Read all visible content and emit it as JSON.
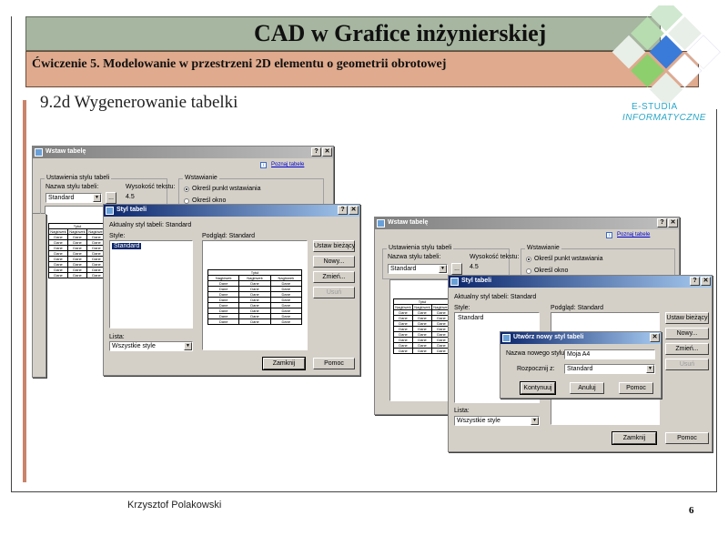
{
  "slide": {
    "title": "CAD w Grafice inżynierskiej",
    "subtitle": "Ćwiczenie 5. Modelowanie w przestrzeni 2D elementu o geometrii obrotowej",
    "section_heading": "9.2d Wygenerowanie tabelki",
    "author": "Krzysztof Polakowski",
    "page_number": "6",
    "logo_line1": "E-STUDIA",
    "logo_line2": "INFORMATYCZNE"
  },
  "colors": {
    "title_bar": "#a7b6a0",
    "subtitle_bar": "#dfaa8d",
    "accent_line": "#c9846a",
    "logo_blue": "#2aa7c9"
  },
  "insert_table_left": {
    "title": "Wstaw tabelę",
    "help_btn": "?",
    "close_btn": "✕",
    "learn_link": "Poznaj tabele",
    "style_group": "Ustawienia stylu tabeli",
    "style_name_label": "Nazwa stylu tabeli:",
    "style_value": "Standard",
    "browse_btn": "...",
    "text_height_label": "Wysokość tekstu:",
    "text_height_value": "4.5",
    "insert_group": "Wstawianie",
    "radio_point": "Określ punkt wstawiania",
    "radio_window": "Określ okno"
  },
  "table_style_left": {
    "title": "Styl tabeli",
    "help_btn": "?",
    "close_btn": "✕",
    "current_label": "Aktualny styl tabeli: Standard",
    "styles_label": "Style:",
    "styles": [
      "Standard"
    ],
    "preview_label": "Podgląd: Standard",
    "list_label": "Lista:",
    "list_value": "Wszystkie style",
    "btn_set_current": "Ustaw bieżący",
    "btn_new": "Nowy...",
    "btn_modify": "Zmień...",
    "btn_delete": "Usuń",
    "btn_close": "Zamknij",
    "btn_help": "Pomoc"
  },
  "preview_table": {
    "title": "Tytuł",
    "headers": [
      "Nagłówek",
      "Nagłówek",
      "Nagłówek"
    ],
    "cell": "Dane",
    "rows": 8
  },
  "insert_table_right": {
    "title": "Wstaw tabelę",
    "help_btn": "?",
    "close_btn": "✕",
    "learn_link": "Poznaj tabele",
    "style_group": "Ustawienia stylu tabeli",
    "style_name_label": "Nazwa stylu tabeli:",
    "style_value": "Standard",
    "browse_btn": "...",
    "text_height_label": "Wysokość tekstu:",
    "text_height_value": "4.5",
    "insert_group": "Wstawianie",
    "radio_point": "Określ punkt wstawiania",
    "radio_window": "Określ okno"
  },
  "table_style_right": {
    "title": "Styl tabeli",
    "help_btn": "?",
    "close_btn": "✕",
    "current_label": "Aktualny styl tabeli: Standard",
    "styles_label": "Style:",
    "styles": [
      "Standard"
    ],
    "preview_label": "Podgląd: Standard",
    "list_label": "Lista:",
    "list_value": "Wszystkie style",
    "btn_set_current": "Ustaw bieżący",
    "btn_new": "Nowy...",
    "btn_modify": "Zmień...",
    "btn_delete": "Usuń",
    "btn_close": "Zamknij",
    "btn_help": "Pomoc"
  },
  "new_style_dialog": {
    "title": "Utwórz nowy styl tabeli",
    "close_btn": "✕",
    "name_label": "Nazwa nowego stylu:",
    "name_value": "Moja A4",
    "start_label": "Rozpocznij z:",
    "start_value": "Standard",
    "btn_continue": "Kontynuuj",
    "btn_cancel": "Anuluj",
    "btn_help": "Pomoc"
  }
}
